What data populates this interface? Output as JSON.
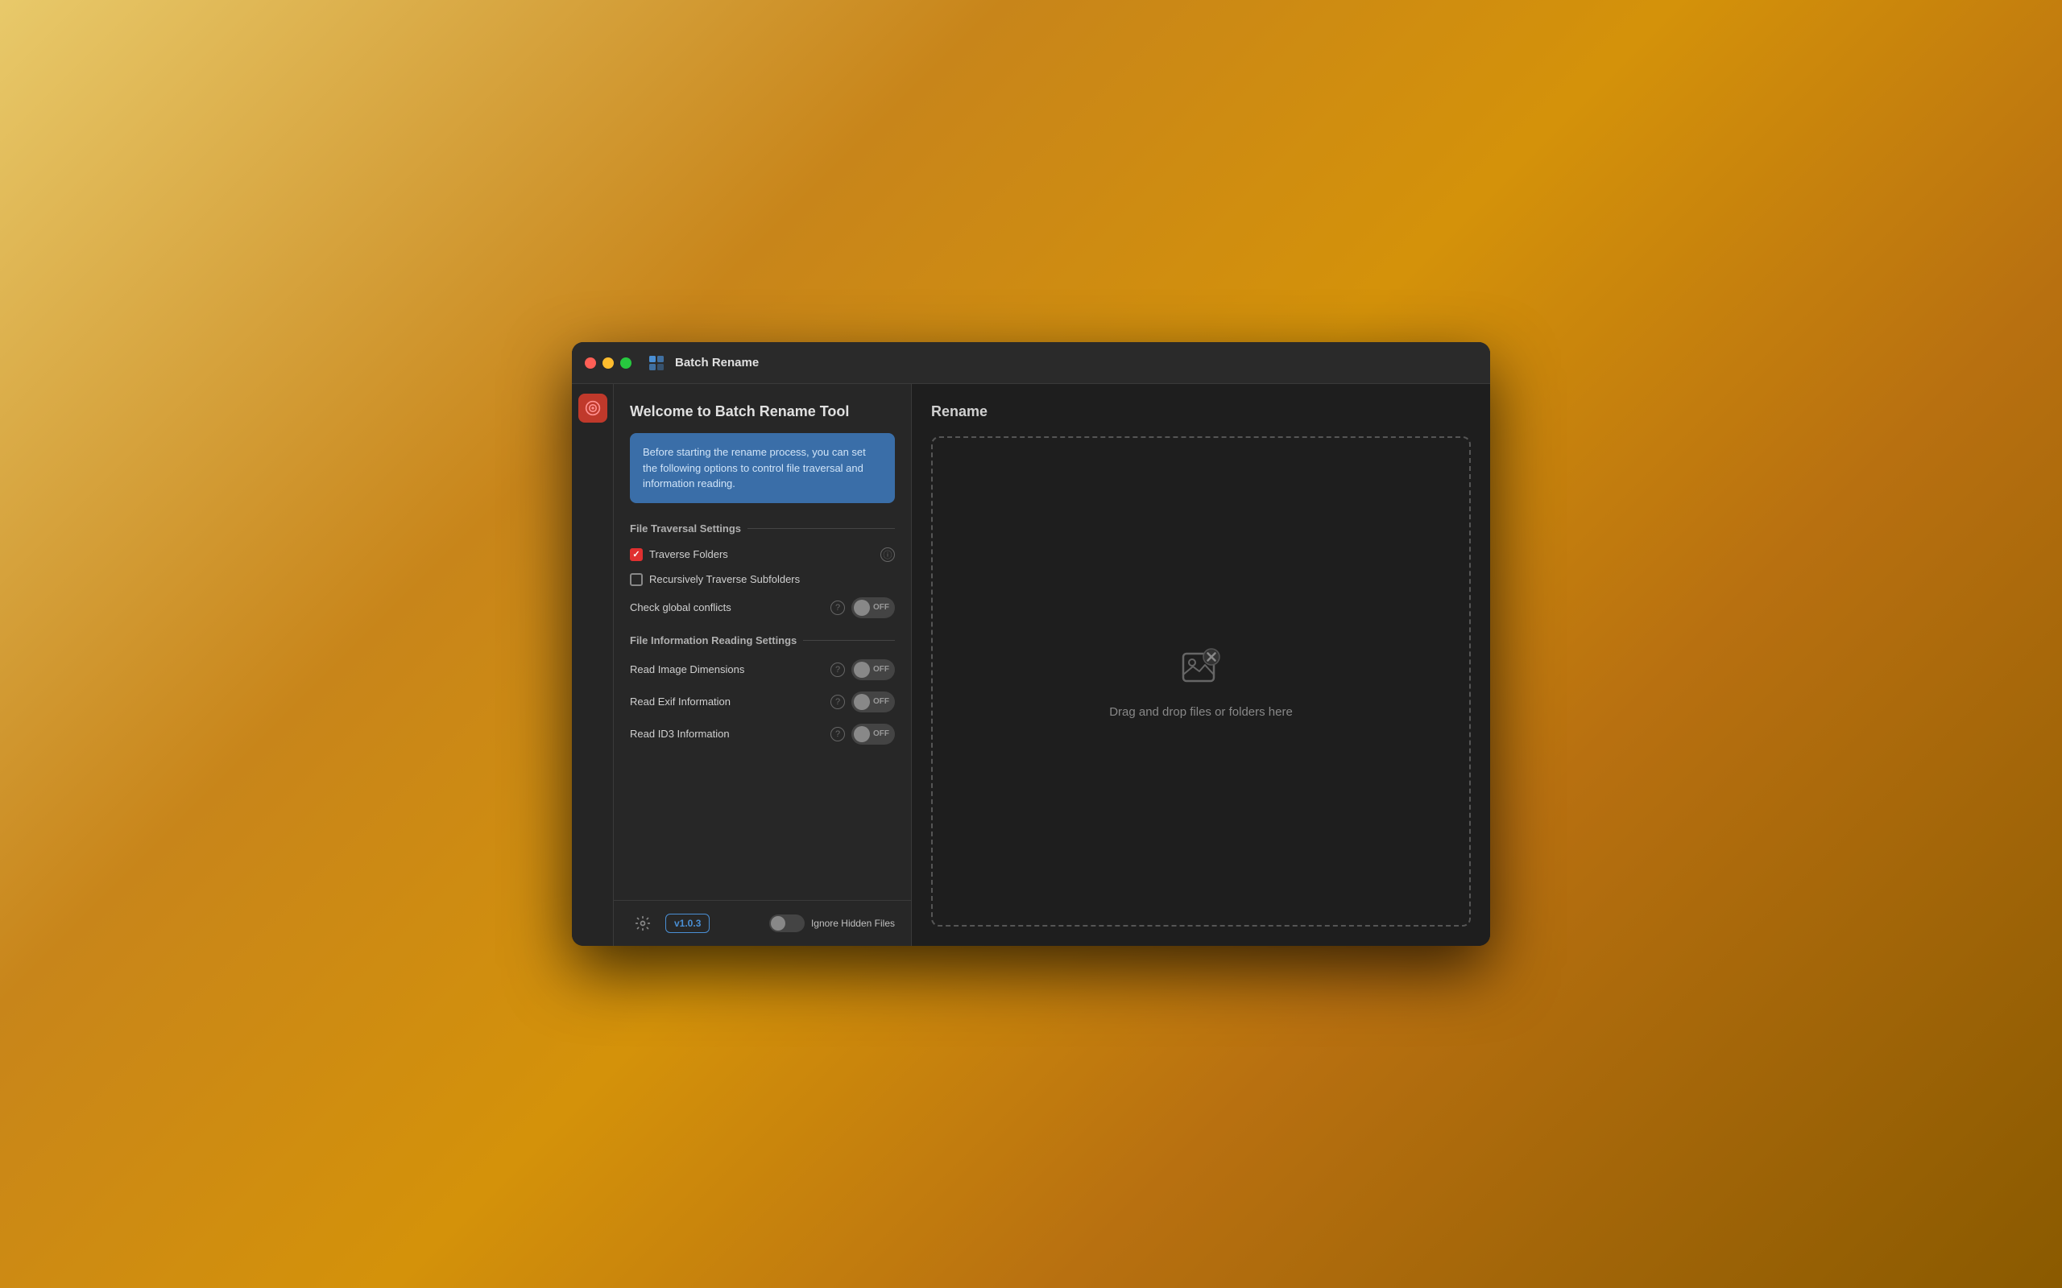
{
  "window": {
    "title": "Batch Rename"
  },
  "titlebar": {
    "title": "Batch Rename"
  },
  "left_panel": {
    "welcome_title": "Welcome to Batch Rename Tool",
    "info_text": "Before starting the rename process, you can set the following options to control file traversal and information reading.",
    "file_traversal": {
      "section_title": "File Traversal Settings",
      "traverse_folders_label": "Traverse Folders",
      "traverse_folders_checked": true,
      "traverse_folders_has_info": true,
      "recursive_subfolders_label": "Recursively Traverse Subfolders",
      "recursive_subfolders_checked": false,
      "check_global_conflicts_label": "Check global conflicts",
      "check_global_conflicts_has_info": true,
      "check_global_conflicts_toggle": "OFF"
    },
    "file_info_reading": {
      "section_title": "File Information Reading Settings",
      "read_image_dimensions_label": "Read Image Dimensions",
      "read_image_dimensions_has_info": true,
      "read_image_dimensions_toggle": "OFF",
      "read_exif_label": "Read Exif Information",
      "read_exif_has_info": true,
      "read_exif_toggle": "OFF",
      "read_id3_label": "Read ID3 Information",
      "read_id3_has_info": true,
      "read_id3_toggle": "OFF"
    }
  },
  "footer": {
    "version": "v1.0.3",
    "ignore_hidden_files_label": "Ignore Hidden Files",
    "ignore_hidden_toggle": "OFF"
  },
  "right_panel": {
    "rename_title": "Rename",
    "drop_text": "Drag and drop files or folders here"
  },
  "icons": {
    "app_icon": "🗂",
    "settings": "⚙",
    "sidebar_icon": "🔄"
  }
}
